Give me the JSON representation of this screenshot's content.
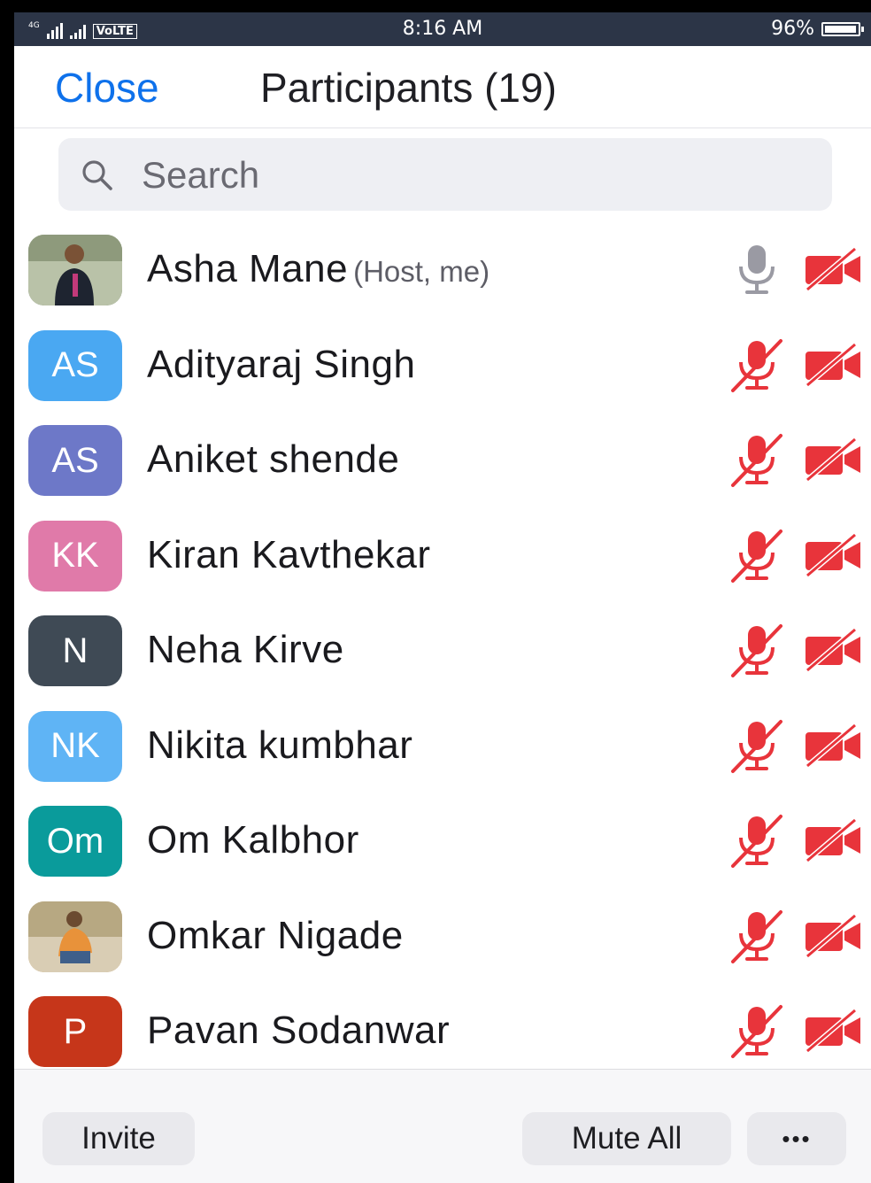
{
  "status_bar": {
    "network": "4G",
    "carrier_tag": "VoLTE",
    "time": "8:16 AM",
    "battery": "96%",
    "battery_level": 0.96
  },
  "header": {
    "close_label": "Close",
    "title": "Participants (19)"
  },
  "search": {
    "placeholder": "Search"
  },
  "colors": {
    "accent": "#0e71eb",
    "muted_red": "#e8343b"
  },
  "participants": [
    {
      "name": "Asha Mane",
      "role": "(Host, me)",
      "avatar_type": "photo",
      "initials": "",
      "avatar_color": "#6b7b5b",
      "mic": "on",
      "video": "off"
    },
    {
      "name": "Adityaraj Singh",
      "role": "",
      "avatar_type": "initials",
      "initials": "AS",
      "avatar_color": "#4aa8f2",
      "mic": "muted",
      "video": "off"
    },
    {
      "name": "Aniket shende",
      "role": "",
      "avatar_type": "initials",
      "initials": "AS",
      "avatar_color": "#6d78c8",
      "mic": "muted",
      "video": "off"
    },
    {
      "name": "Kiran Kavthekar",
      "role": "",
      "avatar_type": "initials",
      "initials": "KK",
      "avatar_color": "#e07aa9",
      "mic": "muted",
      "video": "off"
    },
    {
      "name": "Neha Kirve",
      "role": "",
      "avatar_type": "initials",
      "initials": "N",
      "avatar_color": "#3f4a55",
      "mic": "muted",
      "video": "off"
    },
    {
      "name": "Nikita kumbhar",
      "role": "",
      "avatar_type": "initials",
      "initials": "NK",
      "avatar_color": "#5fb4f5",
      "mic": "muted",
      "video": "off"
    },
    {
      "name": "Om Kalbhor",
      "role": "",
      "avatar_type": "initials",
      "initials": "Om",
      "avatar_color": "#0a9b9b",
      "mic": "muted",
      "video": "off"
    },
    {
      "name": "Omkar Nigade",
      "role": "",
      "avatar_type": "photo",
      "initials": "",
      "avatar_color": "#c9a36a",
      "mic": "muted",
      "video": "off"
    },
    {
      "name": "Pavan Sodanwar",
      "role": "",
      "avatar_type": "initials",
      "initials": "P",
      "avatar_color": "#c6361a",
      "mic": "muted",
      "video": "off"
    }
  ],
  "footer": {
    "invite_label": "Invite",
    "mute_all_label": "Mute All",
    "more_label": "•••"
  }
}
